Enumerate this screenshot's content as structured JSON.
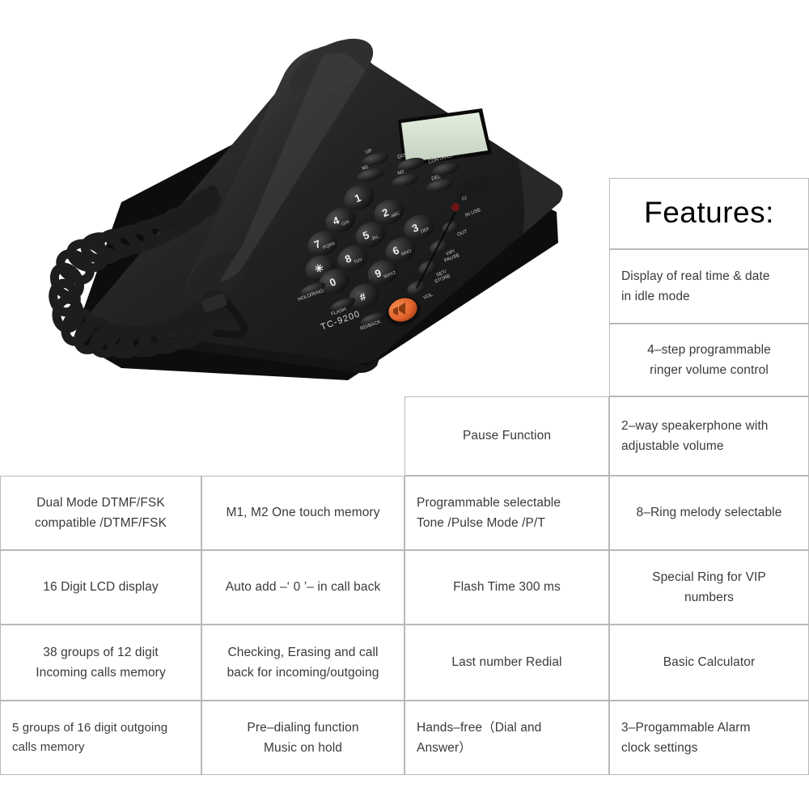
{
  "product": {
    "model_label": "TC-9200",
    "lcd_color": "#d6e0d2",
    "body_color": "#1c1c1c",
    "speaker_button_color": "#e2622c",
    "in_use_led_color": "#8c1b1b",
    "function_buttons": [
      "UP",
      "DOWN",
      "CONTRAST",
      "M1",
      "M2",
      "DEL"
    ],
    "side_buttons": [
      "C/ ",
      "IN USE",
      "OUT",
      "VIP/PAUSE",
      "SET/STORE",
      "VOL"
    ],
    "bottom_buttons": [
      "HOLD/RING",
      "FLASH",
      "RD/BACK"
    ],
    "keypad": [
      {
        "digit": "1",
        "letters": ""
      },
      {
        "digit": "2",
        "letters": "ABC"
      },
      {
        "digit": "3",
        "letters": "DEF"
      },
      {
        "digit": "4",
        "letters": "GHI"
      },
      {
        "digit": "5",
        "letters": "JKL"
      },
      {
        "digit": "6",
        "letters": "MNO"
      },
      {
        "digit": "7",
        "letters": "PQRS"
      },
      {
        "digit": "8",
        "letters": "TUV"
      },
      {
        "digit": "9",
        "letters": "WXYZ"
      },
      {
        "digit": "✱",
        "letters": ""
      },
      {
        "digit": "0",
        "letters": ""
      },
      {
        "digit": "#",
        "letters": ""
      }
    ]
  },
  "features": {
    "heading": "Features:",
    "column4": [
      {
        "lines": [
          "Display of real time & date",
          "in idle mode"
        ],
        "align": "left"
      },
      {
        "lines": [
          "4–step programmable",
          "ringer volume control"
        ],
        "align": "center"
      },
      {
        "lines": [
          "2–way speakerphone with",
          "adjustable volume"
        ],
        "align": "left"
      },
      {
        "lines": [
          "8–Ring melody selectable"
        ],
        "align": "center"
      },
      {
        "lines": [
          "Special Ring for VIP",
          "numbers"
        ],
        "align": "center"
      },
      {
        "lines": [
          "Basic Calculator"
        ],
        "align": "center"
      },
      {
        "lines": [
          "3–Progammable Alarm",
          "clock settings"
        ],
        "align": "left"
      }
    ],
    "column3": [
      {
        "lines": [
          "Pause Function"
        ],
        "align": "center"
      },
      {
        "lines": [
          "Programmable selectable",
          "Tone /Pulse Mode /P/T"
        ],
        "align": "left"
      },
      {
        "lines": [
          "Flash Time 300 ms"
        ],
        "align": "center"
      },
      {
        "lines": [
          "Last number Redial"
        ],
        "align": "center"
      },
      {
        "lines": [
          "Hands–free（Dial and",
          "Answer）"
        ],
        "align": "left"
      }
    ],
    "column2": [
      {
        "lines": [
          "M1, M2 One touch memory"
        ],
        "align": "center"
      },
      {
        "lines": [
          "Auto add –‘ 0 ’– in call back"
        ],
        "align": "center"
      },
      {
        "lines": [
          "Checking, Erasing and call",
          "back for incoming/outgoing"
        ],
        "align": "center"
      },
      {
        "lines": [
          "Pre–dialing function",
          "Music on hold"
        ],
        "align": "center"
      }
    ],
    "column1": [
      {
        "lines": [
          "Dual Mode DTMF/FSK",
          "compatible /DTMF/FSK"
        ],
        "align": "center"
      },
      {
        "lines": [
          "16 Digit LCD display"
        ],
        "align": "center"
      },
      {
        "lines": [
          "38 groups of 12 digit",
          "Incoming calls memory"
        ],
        "align": "center"
      },
      {
        "lines": [
          "5 groups of 16 digit outgoing",
          "calls memory"
        ],
        "align": "left"
      }
    ]
  }
}
